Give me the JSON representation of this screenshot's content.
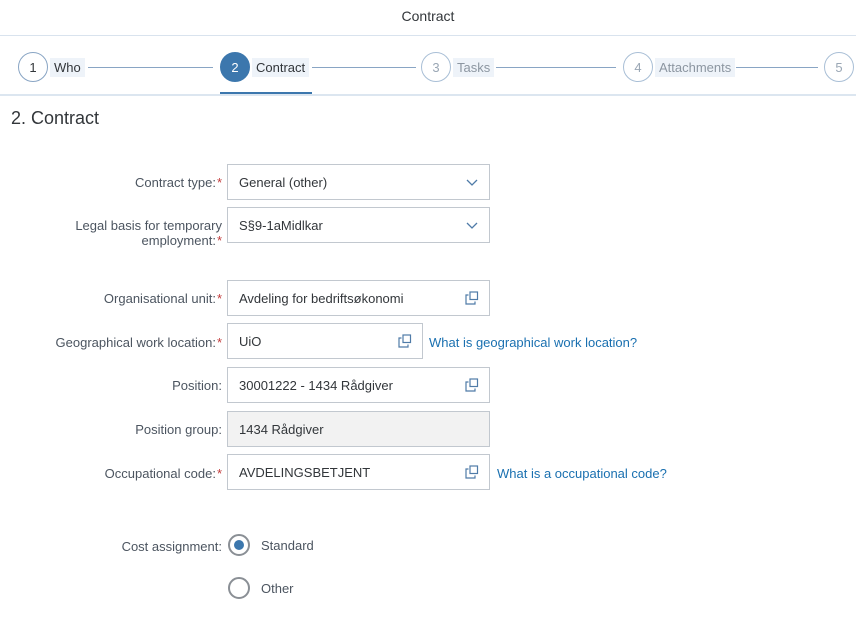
{
  "header": {
    "title": "Contract"
  },
  "wizard": {
    "steps": [
      {
        "number": "1",
        "label": "Who",
        "state": "completed"
      },
      {
        "number": "2",
        "label": "Contract",
        "state": "active"
      },
      {
        "number": "3",
        "label": "Tasks",
        "state": "future"
      },
      {
        "number": "4",
        "label": "Attachments",
        "state": "future"
      },
      {
        "number": "5",
        "label": "",
        "state": "future"
      }
    ]
  },
  "section": {
    "title": "2. Contract"
  },
  "form": {
    "contract_type": {
      "label": "Contract type:",
      "required": "*",
      "value": "General (other)"
    },
    "legal_basis": {
      "label_line1": "Legal basis for temporary",
      "label_line2": "employment:",
      "required": "*",
      "value": "S§9-1aMidlkar"
    },
    "org_unit": {
      "label": "Organisational unit:",
      "required": "*",
      "value": "Avdeling for bedriftsøkonomi"
    },
    "geo_location": {
      "label": "Geographical work location:",
      "required": "*",
      "value": "UiO",
      "help_link": "What is geographical work location?"
    },
    "position": {
      "label": "Position:",
      "value": "30001222 - 1434 Rådgiver"
    },
    "position_group": {
      "label": "Position group:",
      "value": "1434 Rådgiver"
    },
    "occupational_code": {
      "label": "Occupational code:",
      "required": "*",
      "value": "AVDELINGSBETJENT",
      "help_link": "What is a occupational code?"
    },
    "cost_assignment": {
      "label": "Cost assignment:",
      "options": [
        {
          "label": "Standard",
          "selected": true
        },
        {
          "label": "Other",
          "selected": false
        }
      ]
    }
  },
  "colors": {
    "accent": "#3c77ad",
    "link": "#1a70b0",
    "required": "#c23a3a"
  }
}
